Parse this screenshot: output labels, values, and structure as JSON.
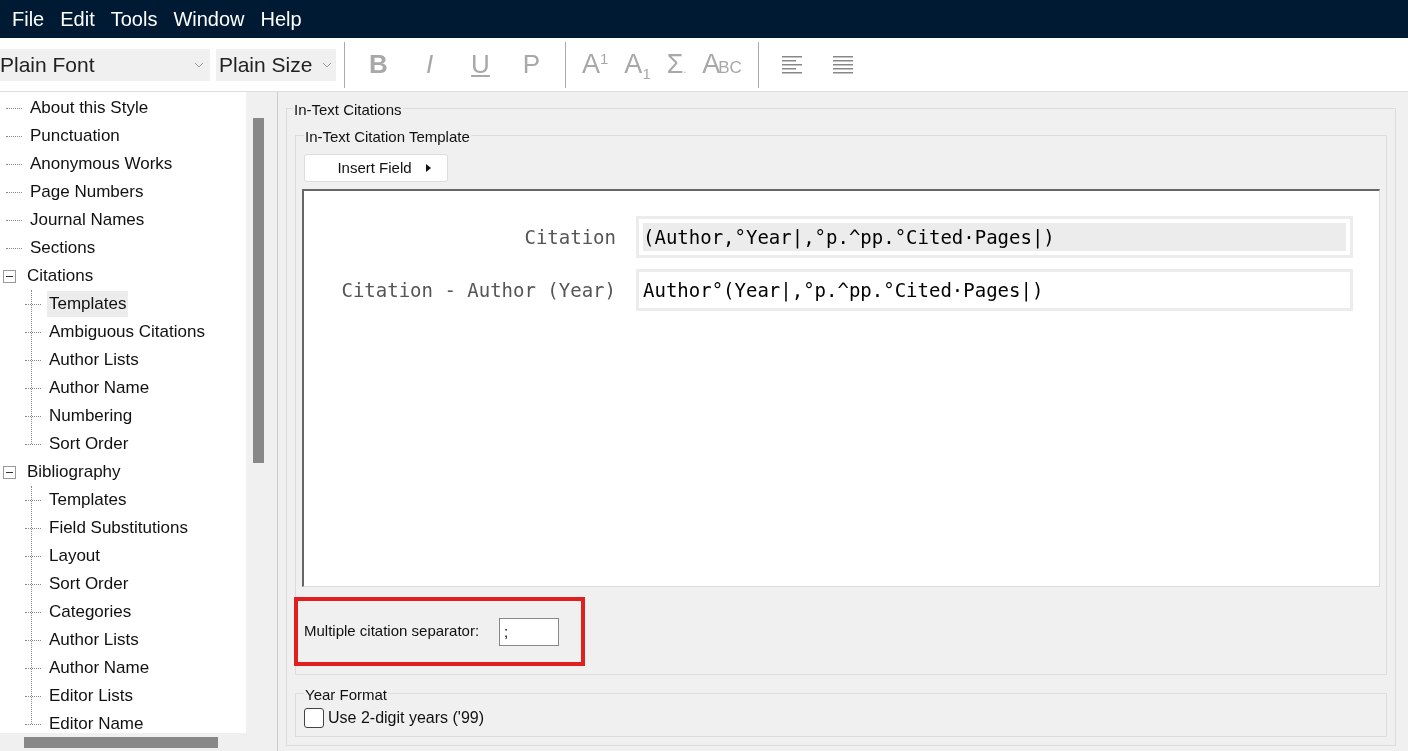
{
  "menu": [
    "File",
    "Edit",
    "Tools",
    "Window",
    "Help"
  ],
  "toolbar": {
    "font": "Plain Font",
    "size": "Plain Size",
    "format_buttons": [
      {
        "kind": "bold",
        "label": "B"
      },
      {
        "kind": "italic",
        "label": "I"
      },
      {
        "kind": "underline",
        "label": "U"
      },
      {
        "kind": "plain",
        "label": "P"
      }
    ],
    "script_buttons": [
      {
        "kind": "superscript",
        "label": "A",
        "mark": "1"
      },
      {
        "kind": "subscript",
        "label": "A",
        "mark": "1"
      },
      {
        "kind": "symbol",
        "label": "Σ",
        "mark": "."
      },
      {
        "kind": "smallcaps",
        "label": "A",
        "mark": "BC"
      }
    ],
    "align_buttons": [
      {
        "kind": "left"
      },
      {
        "kind": "justify"
      }
    ]
  },
  "tree": [
    {
      "label": "About this Style"
    },
    {
      "label": "Punctuation"
    },
    {
      "label": "Anonymous Works"
    },
    {
      "label": "Page Numbers"
    },
    {
      "label": "Journal Names"
    },
    {
      "label": "Sections"
    },
    {
      "label": "Citations",
      "expanded": true,
      "children": [
        {
          "label": "Templates",
          "selected": true
        },
        {
          "label": "Ambiguous Citations",
          "selected": false
        },
        {
          "label": "Author Lists",
          "selected": false
        },
        {
          "label": "Author Name",
          "selected": false
        },
        {
          "label": "Numbering",
          "selected": false
        },
        {
          "label": "Sort Order",
          "selected": false
        }
      ]
    },
    {
      "label": "Bibliography",
      "expanded": true,
      "children": [
        {
          "label": "Templates",
          "selected": false
        },
        {
          "label": "Field Substitutions",
          "selected": false
        },
        {
          "label": "Layout",
          "selected": false
        },
        {
          "label": "Sort Order",
          "selected": false
        },
        {
          "label": "Categories",
          "selected": false
        },
        {
          "label": "Author Lists",
          "selected": false
        },
        {
          "label": "Author Name",
          "selected": false
        },
        {
          "label": "Editor Lists",
          "selected": false
        },
        {
          "label": "Editor Name",
          "selected": false
        }
      ]
    }
  ],
  "section": {
    "title": "In-Text Citations",
    "template_group": "In-Text Citation Template",
    "insert_button": "Insert Field",
    "templates": [
      {
        "label": "Citation",
        "value": "(Author,°Year|,°p.^pp.°Cited·Pages|)",
        "selected": true
      },
      {
        "label": "Citation - Author (Year)",
        "value": "Author°(Year|,°p.^pp.°Cited·Pages|)",
        "selected": false
      }
    ],
    "separator": {
      "label": "Multiple citation separator:",
      "value": ";",
      "highlighted": true
    },
    "year_group": "Year Format",
    "year_option": {
      "label": "Use 2-digit years ('99)",
      "checked": false
    }
  }
}
